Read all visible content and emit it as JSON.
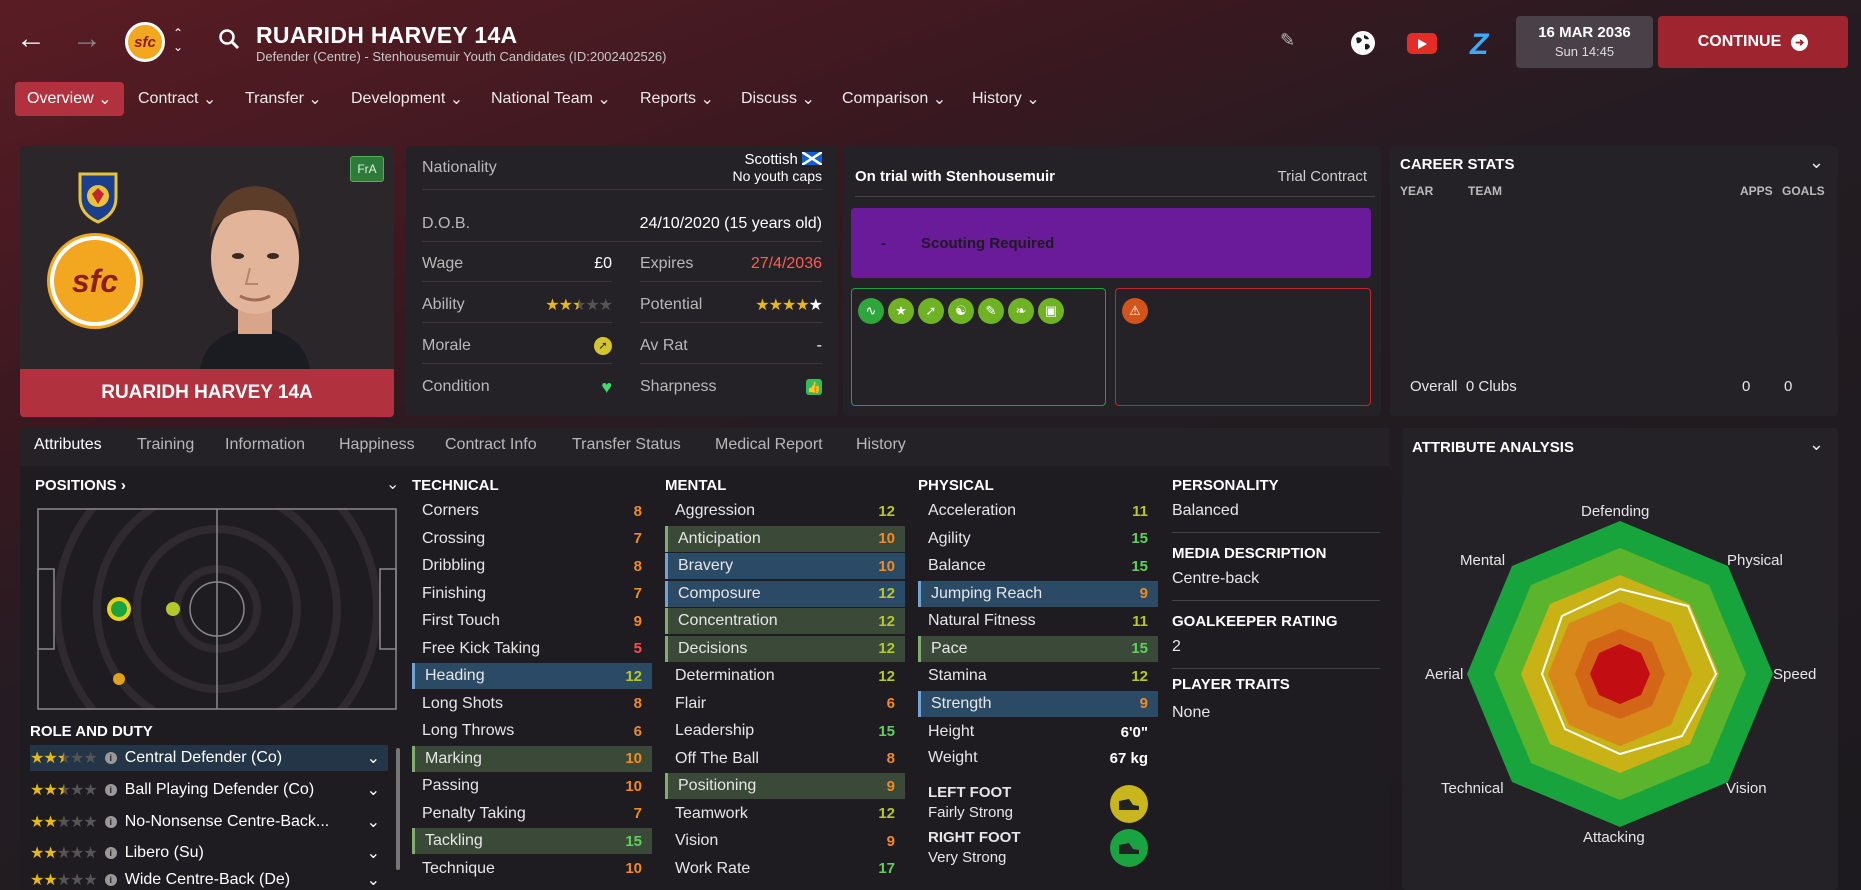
{
  "header": {
    "title": "RUARIDH HARVEY 14A",
    "subtitle": "Defender (Centre) - Stenhousemuir Youth Candidates (ID:2002402526)",
    "date": "16 MAR 2036",
    "time": "Sun 14:45",
    "continue": "CONTINUE",
    "club_abbr": "sfc"
  },
  "menu": [
    "Overview",
    "Contract",
    "Transfer",
    "Development",
    "National Team",
    "Reports",
    "Discuss",
    "Comparison",
    "History"
  ],
  "profile": {
    "name": "RUARIDH HARVEY 14A",
    "tag": "FrA"
  },
  "info": {
    "nationality_label": "Nationality",
    "nationality": "Scottish",
    "caps": "No youth caps",
    "dob_label": "D.O.B.",
    "dob": "24/10/2020 (15 years old)",
    "wage_label": "Wage",
    "wage": "£0",
    "expires_label": "Expires",
    "expires": "27/4/2036",
    "ability_label": "Ability",
    "ability_stars": 2.5,
    "potential_label": "Potential",
    "potential_stars": 5,
    "morale_label": "Morale",
    "avrat_label": "Av Rat",
    "avrat": "-",
    "condition_label": "Condition",
    "sharpness_label": "Sharpness"
  },
  "status": {
    "trial": "On trial with Stenhousemuir",
    "contract": "Trial Contract",
    "scout_dash": "-",
    "scout": "Scouting Required"
  },
  "career": {
    "title": "CAREER STATS",
    "cols": [
      "YEAR",
      "TEAM",
      "APPS",
      "GOALS"
    ],
    "overall": "Overall",
    "clubs": "0 Clubs",
    "apps": "0",
    "goals": "0"
  },
  "tabs": [
    "Attributes",
    "Training",
    "Information",
    "Happiness",
    "Contract Info",
    "Transfer Status",
    "Medical Report",
    "History"
  ],
  "positions_title": "POSITIONS",
  "role_title": "ROLE AND DUTY",
  "roles": [
    {
      "name": "Central Defender (Co)",
      "stars": 2.5
    },
    {
      "name": "Ball Playing Defender (Co)",
      "stars": 2.5
    },
    {
      "name": "No-Nonsense Centre-Back...",
      "stars": 2
    },
    {
      "name": "Libero (Su)",
      "stars": 2
    },
    {
      "name": "Wide Centre-Back (De)",
      "stars": 2
    }
  ],
  "technical": {
    "title": "TECHNICAL",
    "items": [
      [
        "Corners",
        "8"
      ],
      [
        "Crossing",
        "7"
      ],
      [
        "Dribbling",
        "8"
      ],
      [
        "Finishing",
        "7"
      ],
      [
        "First Touch",
        "9"
      ],
      [
        "Free Kick Taking",
        "5"
      ],
      [
        "Heading",
        "12"
      ],
      [
        "Long Shots",
        "8"
      ],
      [
        "Long Throws",
        "6"
      ],
      [
        "Marking",
        "10"
      ],
      [
        "Passing",
        "10"
      ],
      [
        "Penalty Taking",
        "7"
      ],
      [
        "Tackling",
        "15"
      ],
      [
        "Technique",
        "10"
      ]
    ]
  },
  "mental": {
    "title": "MENTAL",
    "items": [
      [
        "Aggression",
        "12"
      ],
      [
        "Anticipation",
        "10"
      ],
      [
        "Bravery",
        "10"
      ],
      [
        "Composure",
        "12"
      ],
      [
        "Concentration",
        "12"
      ],
      [
        "Decisions",
        "12"
      ],
      [
        "Determination",
        "12"
      ],
      [
        "Flair",
        "6"
      ],
      [
        "Leadership",
        "15"
      ],
      [
        "Off The Ball",
        "8"
      ],
      [
        "Positioning",
        "9"
      ],
      [
        "Teamwork",
        "12"
      ],
      [
        "Vision",
        "9"
      ],
      [
        "Work Rate",
        "17"
      ]
    ]
  },
  "physical": {
    "title": "PHYSICAL",
    "items": [
      [
        "Acceleration",
        "11"
      ],
      [
        "Agility",
        "15"
      ],
      [
        "Balance",
        "15"
      ],
      [
        "Jumping Reach",
        "9"
      ],
      [
        "Natural Fitness",
        "11"
      ],
      [
        "Pace",
        "15"
      ],
      [
        "Stamina",
        "12"
      ],
      [
        "Strength",
        "9"
      ]
    ]
  },
  "height_label": "Height",
  "height": "6'0\"",
  "weight_label": "Weight",
  "weight": "67 kg",
  "left_foot_label": "LEFT FOOT",
  "left_foot": "Fairly Strong",
  "right_foot_label": "RIGHT FOOT",
  "right_foot": "Very Strong",
  "personality_h": "PERSONALITY",
  "personality": "Balanced",
  "media_h": "MEDIA DESCRIPTION",
  "media": "Centre-back",
  "gk_h": "GOALKEEPER RATING",
  "gk": "2",
  "traits_h": "PLAYER TRAITS",
  "traits": "None",
  "analysis": {
    "title": "ATTRIBUTE ANALYSIS",
    "labels": [
      "Defending",
      "Physical",
      "Speed",
      "Vision",
      "Attacking",
      "Technical",
      "Aerial",
      "Mental"
    ]
  },
  "colors": {
    "accent": "#b1313e",
    "purple": "#6a1b9a",
    "green": "#1aa341",
    "red": "#c0262f"
  }
}
